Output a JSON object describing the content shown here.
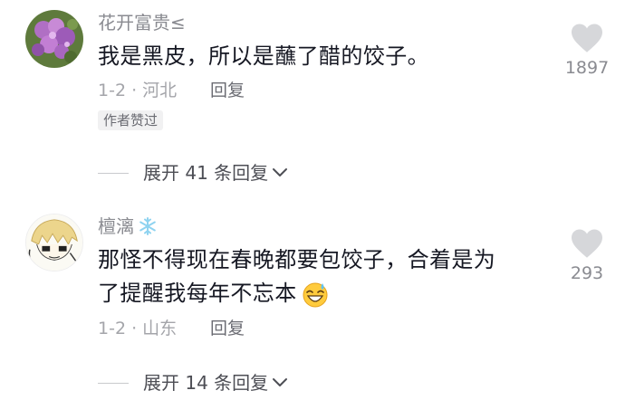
{
  "comments": [
    {
      "username": "花开富贵≤",
      "content": "我是黑皮，所以是蘸了醋的饺子。",
      "meta": "1-2 · 河北",
      "reply_label": "回复",
      "badge": "作者赞过",
      "likes": "1897",
      "expand_label": "展开 41 条回复"
    },
    {
      "username": "檀漓",
      "content_line1": "那怪不得现在春晚都要包饺子，合着是为",
      "content_line2": "了提醒我每年不忘本",
      "meta": "1-2 · 山东",
      "reply_label": "回复",
      "likes": "293",
      "expand_label": "展开 14 条回复"
    }
  ],
  "icons": {
    "heart": "heart-icon",
    "snowflake": "snowflake-icon",
    "emoji": "laughing-sweat-emoji-icon",
    "chevron": "chevron-down-icon"
  }
}
